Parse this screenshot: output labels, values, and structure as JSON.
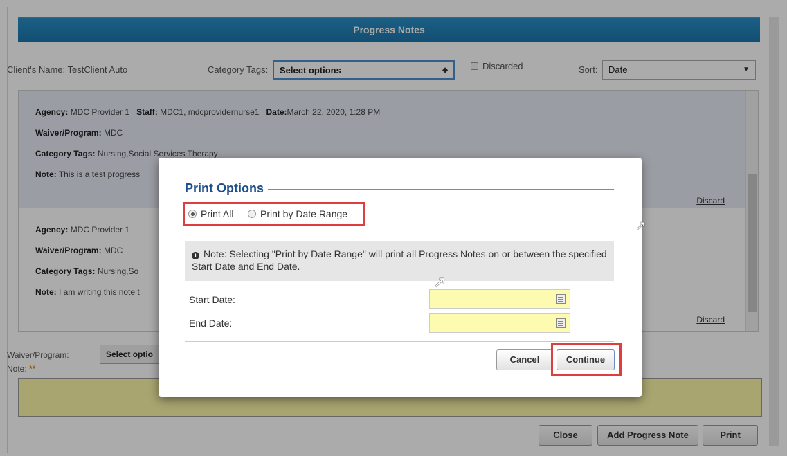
{
  "header": {
    "title": "Progress Notes"
  },
  "filters": {
    "client_label": "Client's Name:",
    "client_value": "TestClient Auto",
    "category_label": "Category Tags:",
    "category_value": "Select options",
    "discarded_label": "Discarded",
    "sort_label": "Sort:",
    "sort_value": "Date"
  },
  "notes": [
    {
      "agency_label": "Agency:",
      "agency": "MDC Provider 1",
      "staff_label": "Staff:",
      "staff": "MDC1, mdcprovidernurse1",
      "date_label": "Date:",
      "date": "March 22, 2020, 1:28 PM",
      "waiver_label": "Waiver/Program:",
      "waiver": "MDC",
      "category_label": "Category Tags:",
      "category": "Nursing,Social Services Therapy",
      "note_label": "Note:",
      "note": "This is a test progress",
      "discard": "Discard"
    },
    {
      "agency_label": "Agency:",
      "agency": "MDC Provider 1",
      "waiver_label": "Waiver/Program:",
      "waiver": "MDC",
      "category_label": "Category Tags:",
      "category": "Nursing,So",
      "note_label": "Note:",
      "note": "I am writing this note t",
      "discard": "Discard"
    }
  ],
  "compose": {
    "waiver_label": "Waiver/Program:",
    "waiver_value": "Select optio",
    "note_label": "Note:",
    "required_mark": "**"
  },
  "footer_buttons": {
    "close": "Close",
    "add": "Add Progress Note",
    "print": "Print"
  },
  "modal": {
    "title": "Print Options",
    "print_all": "Print All",
    "print_range": "Print by Date Range",
    "info": "Note: Selecting \"Print by Date Range\" will print all Progress Notes on or between the specified Start Date and End Date.",
    "start_label": "Start Date:",
    "end_label": "End Date:",
    "cancel": "Cancel",
    "continue": "Continue"
  },
  "colors": {
    "header": "#1c76ac",
    "highlight": "#e03e3e",
    "date_field": "#fcfbb0",
    "modal_title": "#1e4f8a"
  }
}
